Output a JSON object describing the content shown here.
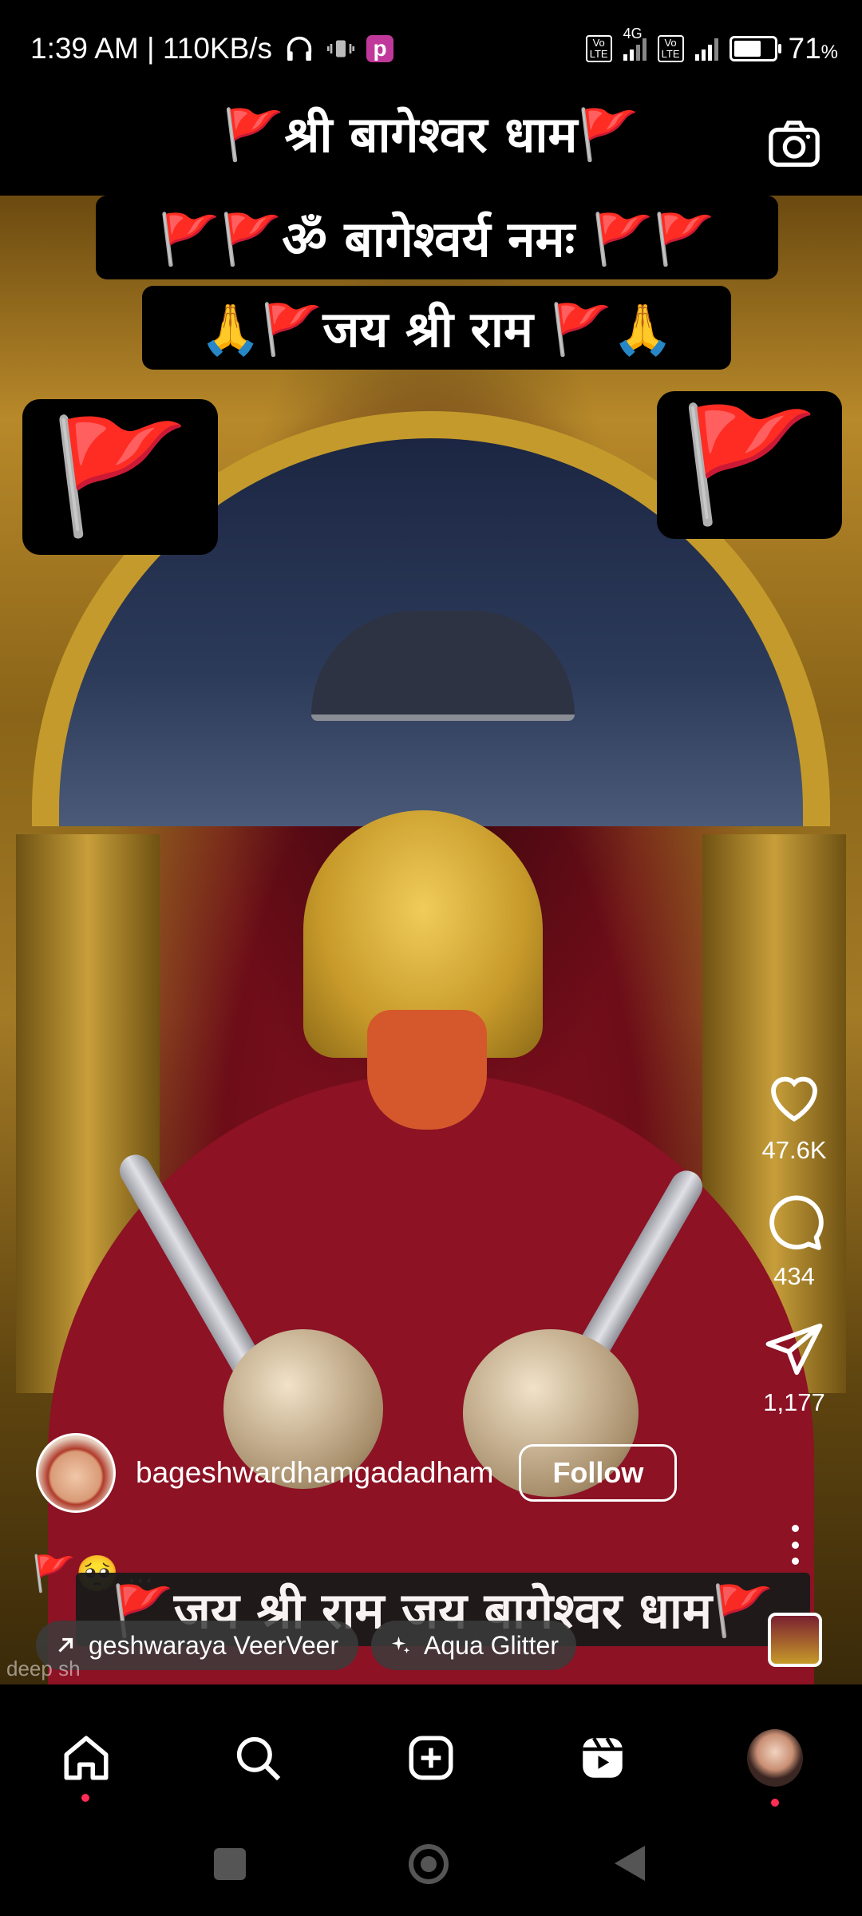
{
  "status_bar": {
    "time_speed": "1:39 AM | 110KB/s",
    "network": "4G",
    "battery": "71",
    "battery_unit": "%",
    "battery_level": 0.71,
    "volte_label": "Vo\nLTE",
    "app_badge": "p"
  },
  "reel": {
    "title_top": "🚩श्री बागेश्वर धाम🚩",
    "banner_1": "🚩🚩ॐ बागेश्वर्य नमः 🚩🚩",
    "banner_2": "🙏🚩जय श्री राम 🚩🙏",
    "flag_emoji": "🚩",
    "bottom_banner": "🚩जय श्री राम जय बागेश्वर धाम🚩",
    "watermark": "deep sh"
  },
  "actions": {
    "likes": "47.6K",
    "comments": "434",
    "shares": "1,177"
  },
  "author": {
    "username": "bageshwardhamgadadham",
    "follow_label": "Follow",
    "caption_emojis": "🚩🥺",
    "caption_more": "..."
  },
  "chips": {
    "audio_label": "geshwaraya VeerVeer",
    "effect_label": "Aqua Glitter"
  },
  "colors": {
    "notification_dot": "#ff2d55",
    "badge": "#c0399a"
  }
}
